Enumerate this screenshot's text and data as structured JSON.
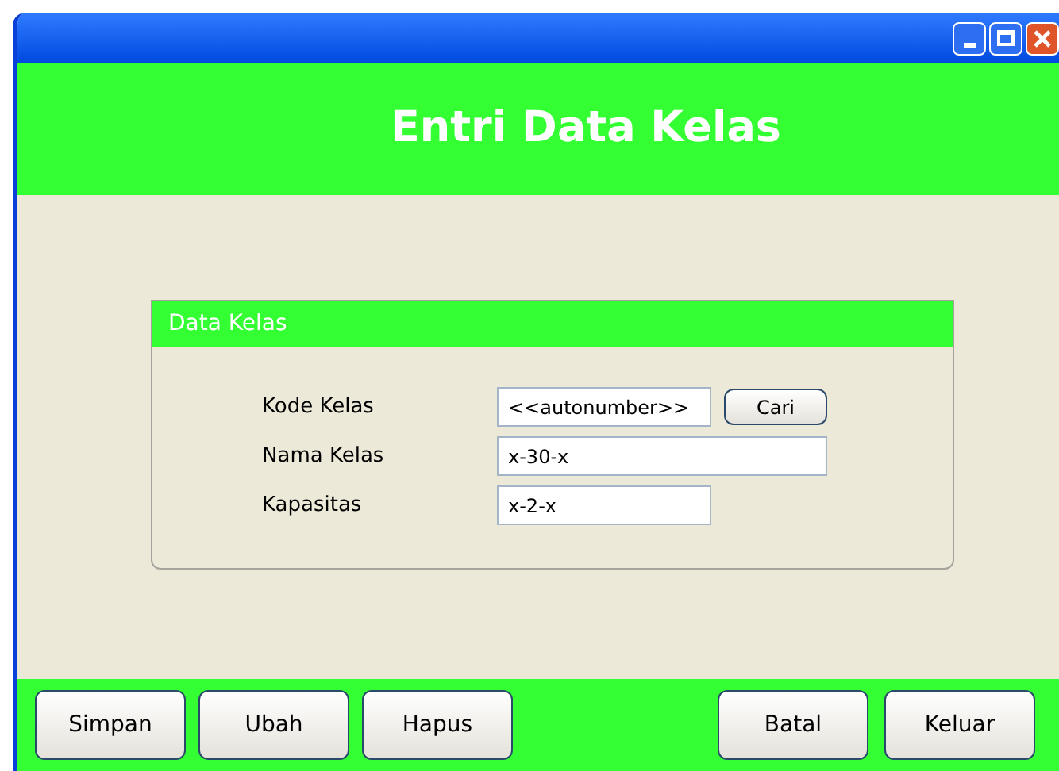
{
  "window": {
    "title": "Entri Data Kelas"
  },
  "panel": {
    "title": "Data Kelas",
    "fields": [
      {
        "label": "Kode Kelas",
        "value": "<<autonumber>>",
        "button": "Cari"
      },
      {
        "label": "Nama Kelas",
        "value": "x-30-x"
      },
      {
        "label": "Kapasitas",
        "value": "x-2-x"
      }
    ]
  },
  "buttons_left": [
    "Simpan",
    "Ubah",
    "Hapus"
  ],
  "buttons_right": [
    "Batal",
    "Keluar"
  ]
}
